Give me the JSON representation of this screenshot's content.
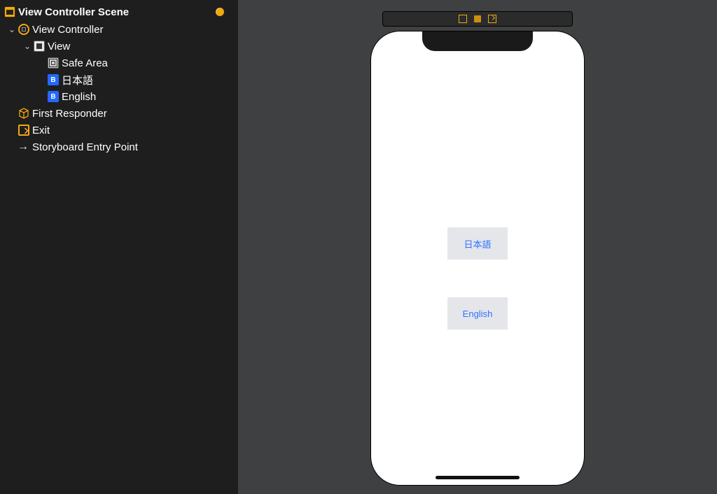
{
  "outline": {
    "scene_title": "View Controller Scene",
    "vc_label": "View Controller",
    "view_label": "View",
    "children": {
      "safe_area": "Safe Area",
      "button_jp": "日本語",
      "button_en": "English"
    },
    "first_responder": "First Responder",
    "exit": "Exit",
    "entry_point": "Storyboard Entry Point"
  },
  "device": {
    "button_jp": "日本語",
    "button_en": "English"
  },
  "colors": {
    "accent": "#f0a90f",
    "ios_tint": "#2d73ff",
    "button_bg": "#e5e6ea"
  }
}
